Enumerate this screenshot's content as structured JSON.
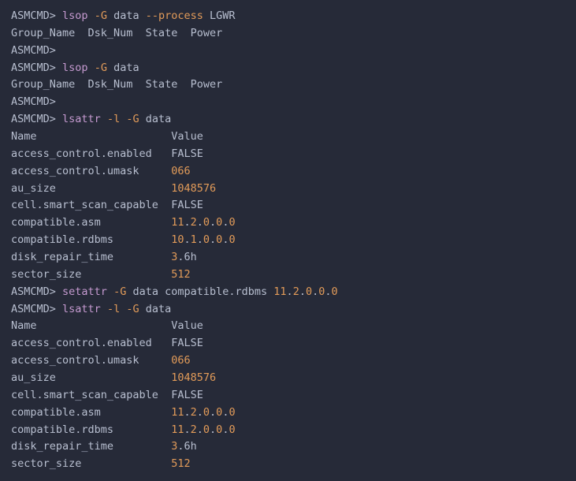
{
  "prompt": "ASMCMD>",
  "gt": ">",
  "cmds": {
    "lsop": "lsop",
    "lsattr": "lsattr",
    "setattr": "setattr",
    "G": "-G",
    "l": "-l",
    "process": "--process",
    "data": "data",
    "comp_rdbms": "compatible.rdbms",
    "lgwr": "LGWR",
    "v11_2_0_0_0": {
      "a": "11",
      "b": "2",
      "c": "0",
      "d": "0",
      "e": "0"
    }
  },
  "headers": {
    "lsop": "Group_Name  Dsk_Num  State  Power",
    "attr_name": "Name",
    "attr_value": "Value"
  },
  "attrs1": [
    {
      "name": "access_control.enabled",
      "val": "FALSE",
      "num": false
    },
    {
      "name": "access_control.umask",
      "val": "066",
      "num": true
    },
    {
      "name": "au_size",
      "val": "1048576",
      "num": true
    },
    {
      "name": "cell.smart_scan_capable",
      "val": "FALSE",
      "num": false
    },
    {
      "name": "compatible.asm",
      "ver": {
        "a": "11",
        "b": "2",
        "c": "0",
        "d": "0",
        "e": "0"
      }
    },
    {
      "name": "compatible.rdbms",
      "ver": {
        "a": "10",
        "b": "1",
        "c": "0",
        "d": "0",
        "e": "0"
      }
    },
    {
      "name": "disk_repair_time",
      "mix": {
        "n": "3",
        "s": ".6h"
      }
    },
    {
      "name": "sector_size",
      "val": "512",
      "num": true
    }
  ],
  "attrs2": [
    {
      "name": "access_control.enabled",
      "val": "FALSE",
      "num": false
    },
    {
      "name": "access_control.umask",
      "val": "066",
      "num": true
    },
    {
      "name": "au_size",
      "val": "1048576",
      "num": true
    },
    {
      "name": "cell.smart_scan_capable",
      "val": "FALSE",
      "num": false
    },
    {
      "name": "compatible.asm",
      "ver": {
        "a": "11",
        "b": "2",
        "c": "0",
        "d": "0",
        "e": "0"
      }
    },
    {
      "name": "compatible.rdbms",
      "ver": {
        "a": "11",
        "b": "2",
        "c": "0",
        "d": "0",
        "e": "0"
      }
    },
    {
      "name": "disk_repair_time",
      "mix": {
        "n": "3",
        "s": ".6h"
      }
    },
    {
      "name": "sector_size",
      "val": "512",
      "num": true
    }
  ]
}
